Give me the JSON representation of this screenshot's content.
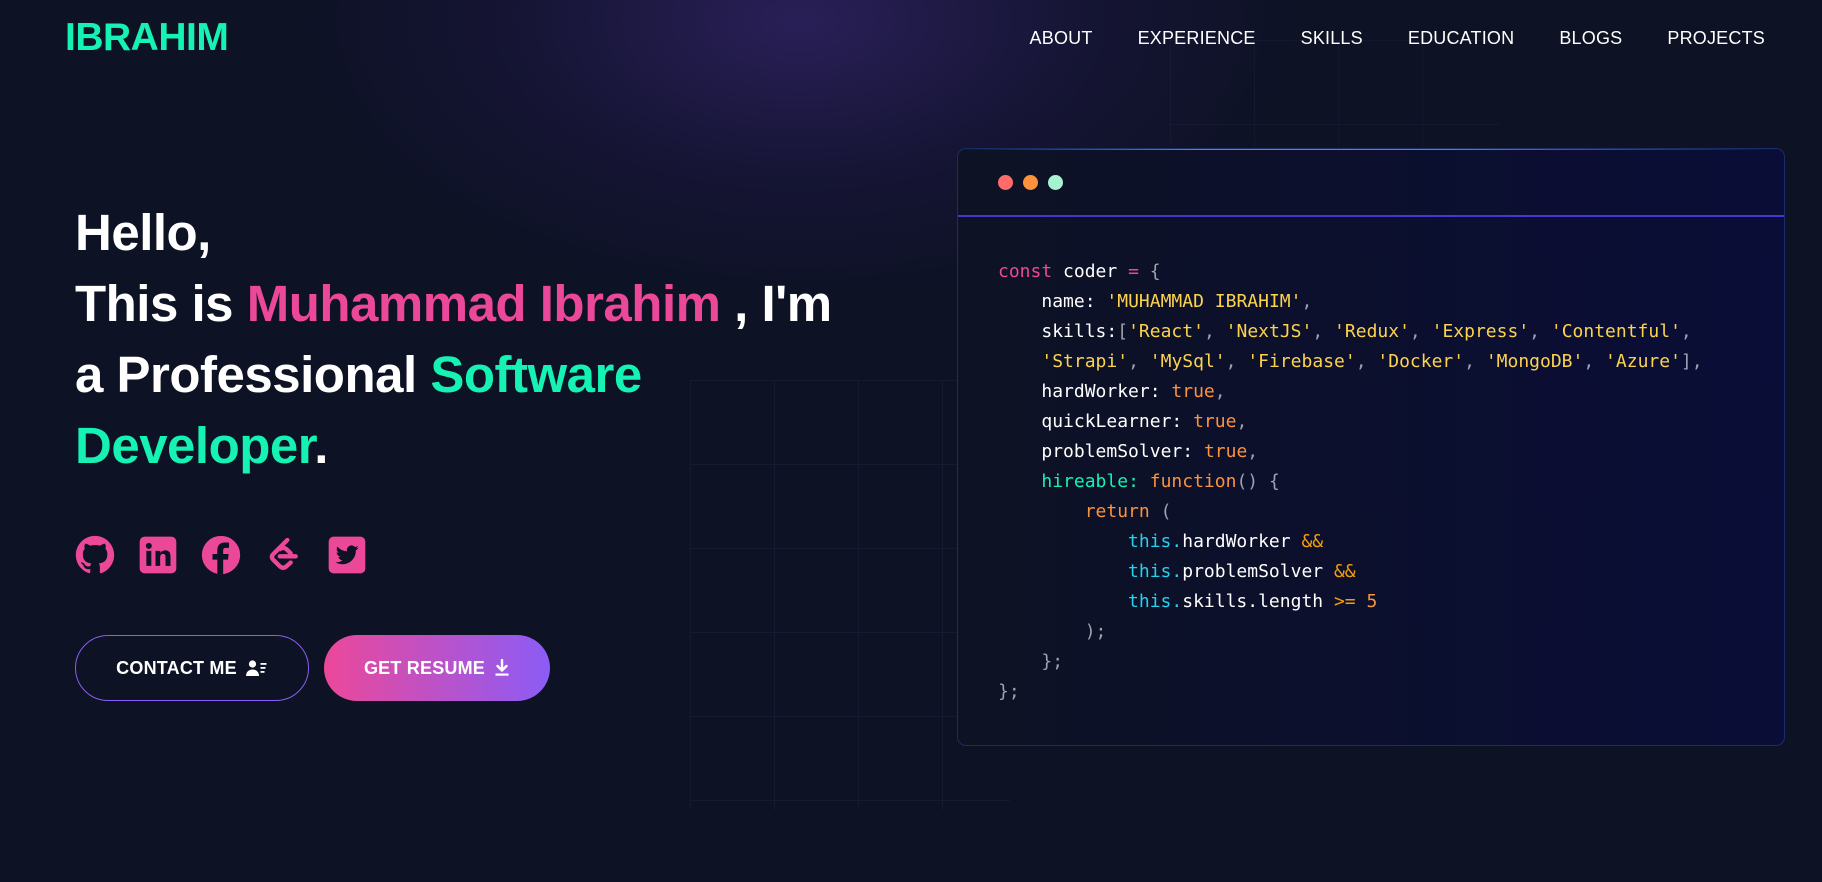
{
  "header": {
    "logo": "IBRAHIM",
    "nav": [
      "ABOUT",
      "EXPERIENCE",
      "SKILLS",
      "EDUCATION",
      "BLOGS",
      "PROJECTS"
    ]
  },
  "hero": {
    "greeting": "Hello,",
    "intro_prefix": "This is ",
    "name": "Muhammad Ibrahim",
    "intro_suffix": " , I'm",
    "role_prefix": "a Professional ",
    "role_word1": "Software",
    "role_word2": "Developer",
    "period": "."
  },
  "socials": [
    {
      "icon": "github-icon"
    },
    {
      "icon": "linkedin-icon"
    },
    {
      "icon": "facebook-icon"
    },
    {
      "icon": "leetcode-icon"
    },
    {
      "icon": "twitter-icon"
    }
  ],
  "buttons": {
    "contact": "CONTACT ME",
    "resume": "GET RESUME"
  },
  "code_window": {
    "dots": [
      "#ff6b6b",
      "#fb923c",
      "#a7f3d0"
    ],
    "const_kw": "const",
    "var_name": "coder",
    "name_key": "name",
    "name_value": "'MUHAMMAD IBRAHIM'",
    "skills_key": "skills",
    "skills": [
      "React",
      "NextJS",
      "Redux",
      "Express",
      "Contentful",
      "Strapi",
      "MySql",
      "Firebase",
      "Docker",
      "MongoDB",
      "Azure"
    ],
    "hard_worker_key": "hardWorker",
    "quick_learner_key": "quickLearner",
    "problem_solver_key": "problemSolver",
    "bool_value": "true",
    "hireable_key": "hireable",
    "function_kw": "function",
    "return_kw": "return",
    "this_kw": "this.",
    "skills_length": "skills.length",
    "compare_op": ">=",
    "min_skills": "5"
  },
  "colors": {
    "accent_green": "#16f2b3",
    "accent_pink": "#ec4899",
    "accent_purple": "#8b5cf6",
    "background": "#0d1224"
  }
}
